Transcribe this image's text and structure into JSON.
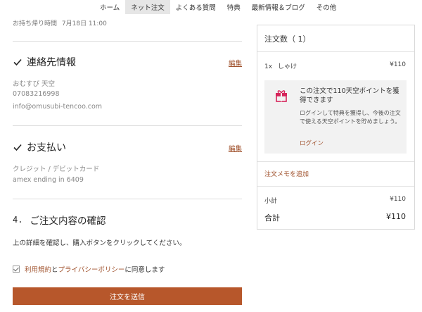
{
  "nav": {
    "items": [
      "ホーム",
      "ネット注文",
      "よくある質問",
      "特典",
      "最新情報＆ブログ",
      "その他"
    ],
    "active_index": 1
  },
  "pickup": {
    "label": "お持ち帰り時間",
    "value": "7月18日 11:00"
  },
  "contact": {
    "title": "連絡先情報",
    "edit_label": "編集",
    "name": "おむすび 天空",
    "phone": "07083216998",
    "email": "info@omusubi-tencoo.com"
  },
  "payment": {
    "title": "お支払い",
    "edit_label": "編集",
    "method": "クレジット / デビットカード",
    "card": "amex ending in 6409"
  },
  "review": {
    "step": "4.",
    "title": "ご注文内容の確認",
    "instruction": "上の詳細を確認し、購入ボタンをクリックしてください。",
    "agree_prefix": "",
    "terms_link": "利用規約",
    "and": "と",
    "privacy_link": "プライバシーポリシー",
    "agree_suffix": "に同意します",
    "submit_label": "注文を送信"
  },
  "summary": {
    "head": "注文数（ 1）",
    "item": {
      "qty": "1x",
      "name": "しゃけ",
      "price": "¥110"
    },
    "promo": {
      "title": "この注文で110天空ポイントを獲得できます",
      "body": "ログインして特典を獲得し、今後の注文で使える天空ポイントを貯めましょう。",
      "login_label": "ログイン"
    },
    "memo_link": "注文メモを追加",
    "subtotal_label": "小計",
    "subtotal_value": "¥110",
    "total_label": "合計",
    "total_value": "¥110"
  },
  "colors": {
    "accent": "#b7572b",
    "link": "#a0522d",
    "gift": "#d6245a"
  }
}
